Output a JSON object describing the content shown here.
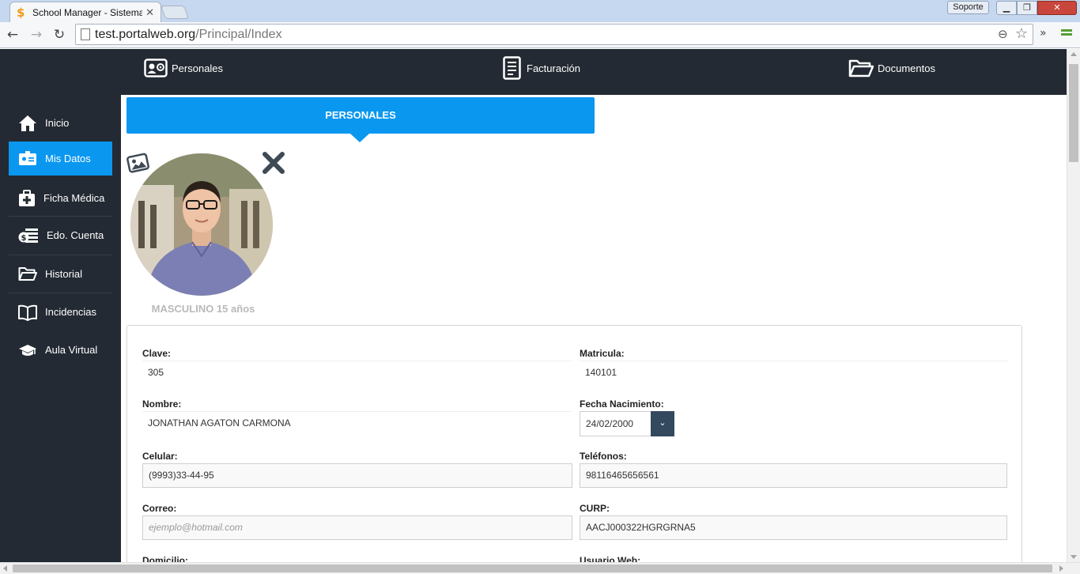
{
  "browser": {
    "tab_title": "School Manager - Sistema",
    "url_host": "test.portalweb.org",
    "url_path": "/Principal/Index",
    "soporte_label": "Soporte"
  },
  "topnav": {
    "items": [
      {
        "label": "Personales",
        "icon": "id-card-icon"
      },
      {
        "label": "Facturación",
        "icon": "invoice-icon"
      },
      {
        "label": "Documentos",
        "icon": "folder-open-icon"
      }
    ]
  },
  "sidebar": {
    "items": [
      {
        "label": "Inicio",
        "icon": "home-icon"
      },
      {
        "label": "Mis Datos",
        "icon": "id-badge-icon",
        "active": true
      },
      {
        "label": "Ficha Médica",
        "icon": "medical-kit-icon"
      },
      {
        "label": "Edo. Cuenta",
        "icon": "money-icon"
      },
      {
        "label": "Historial",
        "icon": "folder-icon"
      },
      {
        "label": "Incidencias",
        "icon": "book-icon"
      },
      {
        "label": "Aula Virtual",
        "icon": "graduation-cap-icon"
      }
    ]
  },
  "section": {
    "title": "PERSONALES"
  },
  "profile": {
    "gender_age": "MASCULINO 15 años"
  },
  "form": {
    "clave": {
      "label": "Clave:",
      "value": "305"
    },
    "matricula": {
      "label": "Matricula:",
      "value": "140101"
    },
    "nombre": {
      "label": "Nombre:",
      "value": "JONATHAN  AGATON CARMONA"
    },
    "fecha_nacimiento": {
      "label": "Fecha Nacimiento:",
      "value": "24/02/2000"
    },
    "celular": {
      "label": "Celular:",
      "value": "(9993)33-44-95"
    },
    "telefonos": {
      "label": "Teléfonos:",
      "value": "98116465656561"
    },
    "correo": {
      "label": "Correo:",
      "placeholder": "ejemplo@hotmail.com"
    },
    "curp": {
      "label": "CURP:",
      "value": "AACJ000322HGRGRNA5"
    },
    "domicilio": {
      "label": "Domicilio:"
    },
    "usuario_web": {
      "label": "Usuario Web:"
    }
  },
  "colors": {
    "accent": "#0a97f0",
    "nav_dark": "#232a33",
    "date_button": "#34495e"
  }
}
